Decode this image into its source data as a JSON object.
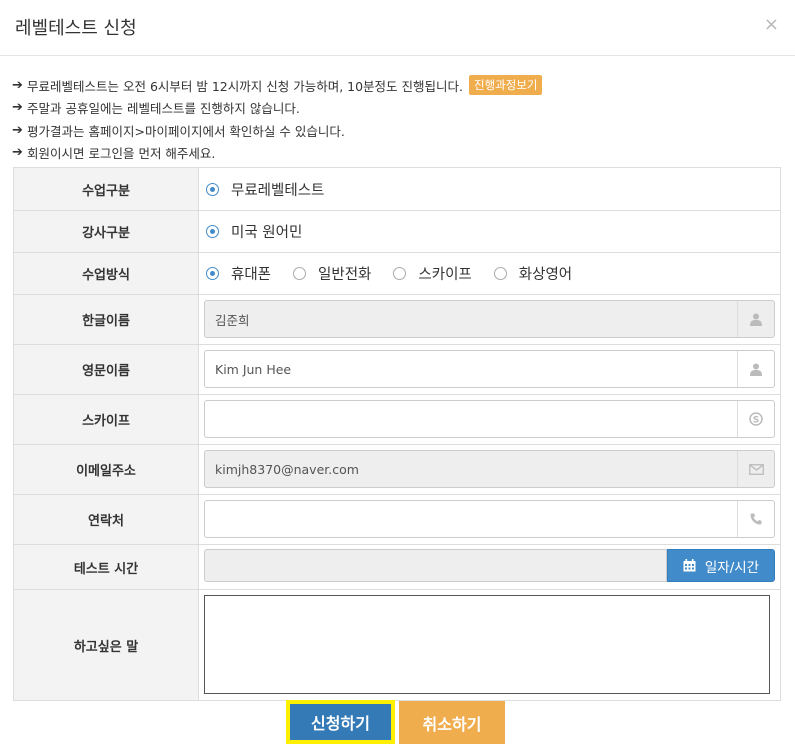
{
  "modal": {
    "title": "레벨테스트 신청",
    "close": "×"
  },
  "notices": [
    "무료레벨테스트는 오전 6시부터 밤 12시까지 신청 가능하며, 10분정도 진행됩니다.",
    "주말과 공휴일에는 레벨테스트를 진행하지 않습니다.",
    "평가결과는 홈페이지>마이페이지에서 확인하실 수 있습니다.",
    "회원이시면 로그인을 먼저 해주세요."
  ],
  "notice_button": "진행과정보기",
  "form": {
    "class_type": {
      "label": "수업구분",
      "options": [
        "무료레벨테스트"
      ],
      "selected": "무료레벨테스트"
    },
    "teacher_type": {
      "label": "강사구분",
      "options": [
        "미국 원어민"
      ],
      "selected": "미국 원어민"
    },
    "class_method": {
      "label": "수업방식",
      "options": [
        "휴대폰",
        "일반전화",
        "스카이프",
        "화상영어"
      ],
      "selected": "휴대폰"
    },
    "korean_name": {
      "label": "한글이름",
      "value": "김준희",
      "icon": "user-icon"
    },
    "english_name": {
      "label": "영문이름",
      "value": "Kim Jun Hee",
      "icon": "user-icon"
    },
    "skype": {
      "label": "스카이프",
      "value": "",
      "icon": "skype-icon"
    },
    "email": {
      "label": "이메일주소",
      "value": "kimjh8370@naver.com",
      "icon": "envelope-icon"
    },
    "phone": {
      "label": "연락처",
      "value": "",
      "icon": "phone-icon"
    },
    "test_time": {
      "label": "테스트 시간",
      "value": "",
      "button": "일자/시간",
      "icon": "calendar-icon"
    },
    "message": {
      "label": "하고싶은 말",
      "value": ""
    }
  },
  "buttons": {
    "submit": "신청하기",
    "cancel": "취소하기"
  },
  "colors": {
    "primary": "#337ab7",
    "warning": "#f0ad4e",
    "highlight": "#ffef00",
    "label_bg": "#f3f3f3"
  }
}
